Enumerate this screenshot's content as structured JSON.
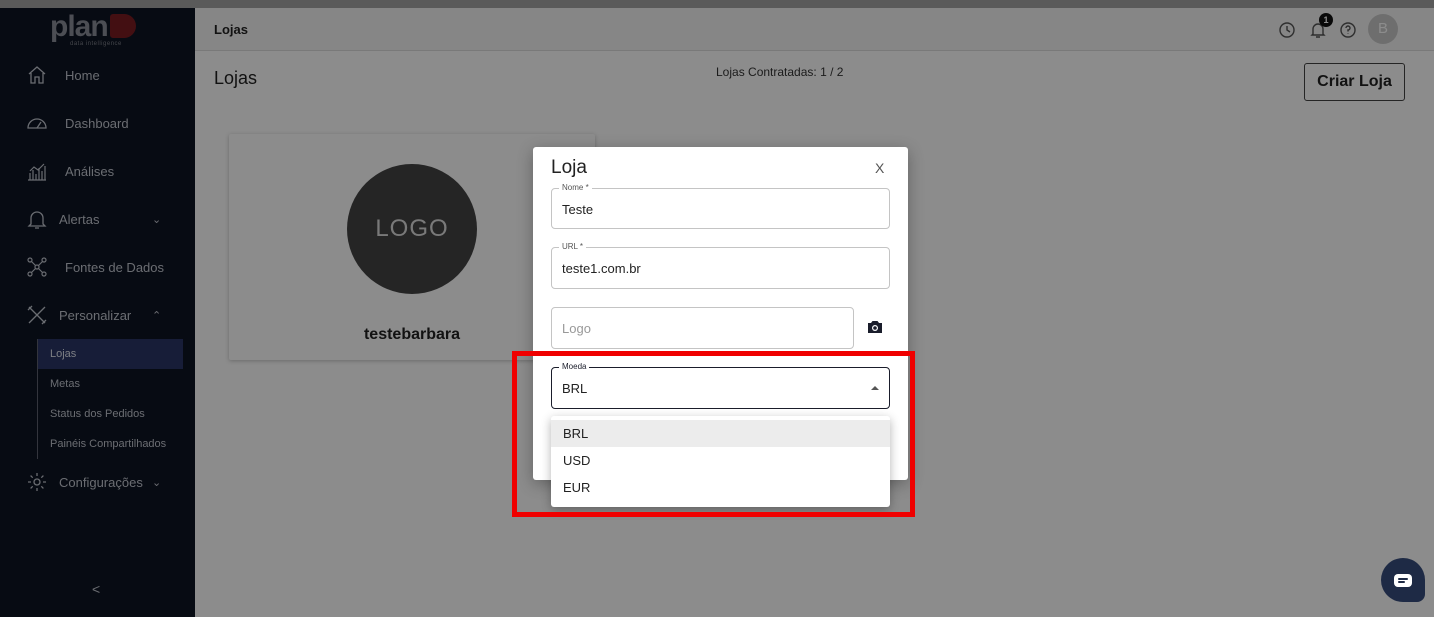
{
  "brand": {
    "logo_text": "plan",
    "logo_sub": "data intelligence"
  },
  "sidebar": {
    "items": [
      {
        "label": "Home",
        "icon": "home-icon"
      },
      {
        "label": "Dashboard",
        "icon": "speedometer-icon"
      },
      {
        "label": "Análises",
        "icon": "analytics-icon"
      },
      {
        "label": "Alertas",
        "icon": "bell-icon",
        "chevron": "⌄"
      },
      {
        "label": "Fontes de Dados",
        "icon": "data-sources-icon"
      },
      {
        "label": "Personalizar",
        "icon": "tools-icon",
        "chevron": "⌃"
      },
      {
        "label": "Configurações",
        "icon": "gear-icon",
        "chevron": "⌄"
      }
    ],
    "sub_items": [
      {
        "label": "Lojas",
        "active": true
      },
      {
        "label": "Metas"
      },
      {
        "label": "Status dos Pedidos"
      },
      {
        "label": "Painéis Compartilhados"
      }
    ],
    "collapse": "<"
  },
  "header": {
    "title": "Lojas",
    "notification_count": "1",
    "avatar_initial": "B"
  },
  "main": {
    "page_title": "Lojas",
    "contracted": "Lojas Contratadas: 1 / 2",
    "create_button": "Criar Loja",
    "store_card": {
      "logo": "LOGO",
      "name": "testebarbara"
    }
  },
  "dialog": {
    "title": "Loja",
    "close": "X",
    "fields": {
      "name": {
        "label": "Nome *",
        "value": "Teste"
      },
      "url": {
        "label": "URL *",
        "value": "teste1.com.br"
      },
      "logo": {
        "placeholder": "Logo"
      },
      "currency": {
        "label": "Moeda",
        "value": "BRL"
      }
    }
  },
  "currency_menu": {
    "options": [
      "BRL",
      "USD",
      "EUR"
    ],
    "selected": "BRL"
  },
  "colors": {
    "sidebar_bg": "#0e1423",
    "active_sub_bg": "#2b3566",
    "highlight": "#f00000",
    "chat_bg": "#1e2a45"
  }
}
